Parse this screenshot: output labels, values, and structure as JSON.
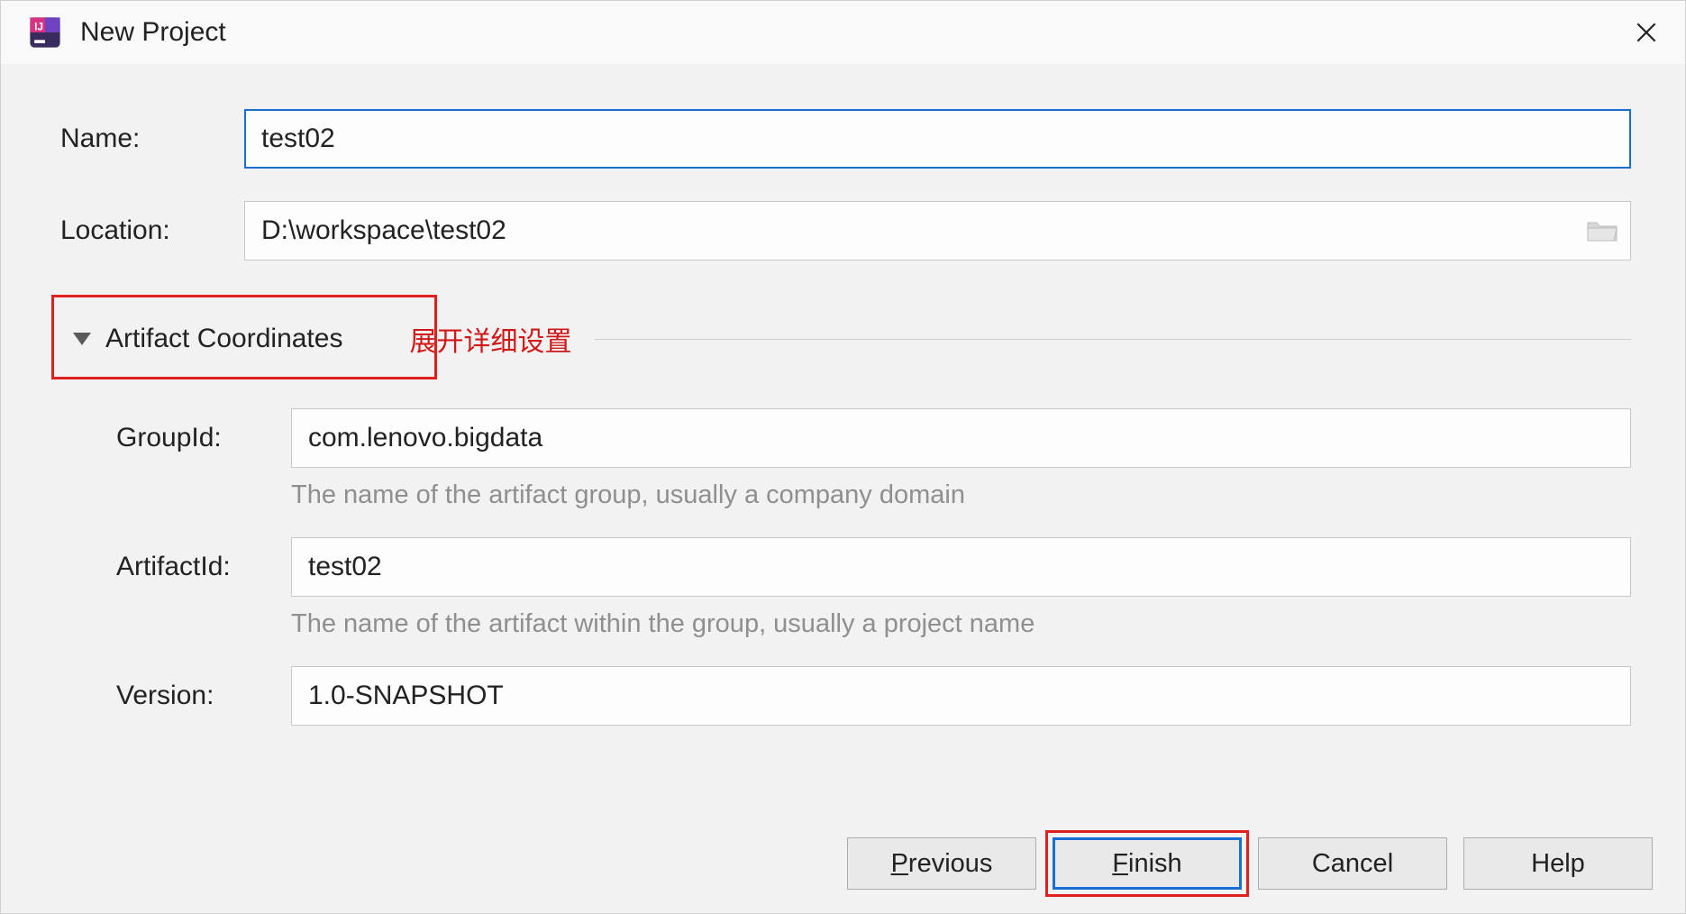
{
  "window": {
    "title": "New Project"
  },
  "fields": {
    "name_label": "Name:",
    "name_value": "test02",
    "location_label": "Location:",
    "location_value": "D:\\workspace\\test02"
  },
  "section": {
    "title": "Artifact Coordinates",
    "annotation": "展开详细设置"
  },
  "artifact": {
    "groupid_label": "GroupId:",
    "groupid_value": "com.lenovo.bigdata",
    "groupid_hint": "The name of the artifact group, usually a company domain",
    "artifactid_label": "ArtifactId:",
    "artifactid_value": "test02",
    "artifactid_hint": "The name of the artifact within the group, usually a project name",
    "version_label": "Version:",
    "version_value": "1.0-SNAPSHOT"
  },
  "buttons": {
    "previous": "revious",
    "previous_u": "P",
    "finish": "inish",
    "finish_u": "F",
    "cancel": "Cancel",
    "help": "Help"
  }
}
